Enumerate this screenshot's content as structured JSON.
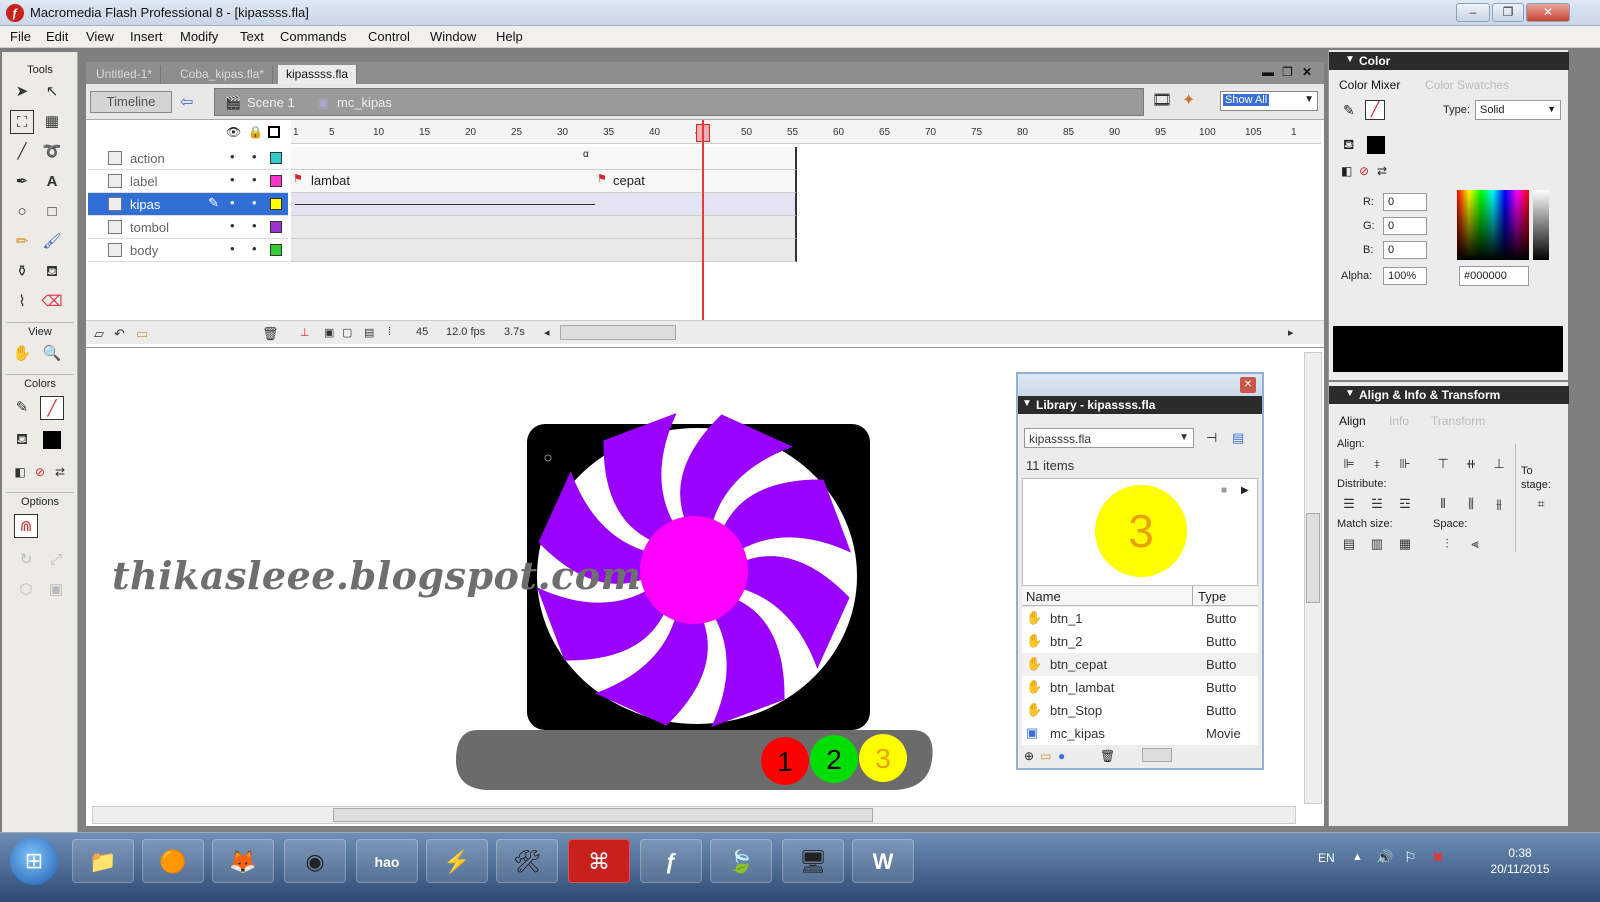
{
  "window": {
    "title": "Macromedia Flash Professional 8 - [kipassss.fla]",
    "app_icon": "flash-logo-icon",
    "controls": [
      "–",
      "❐",
      "✕"
    ]
  },
  "menubar": [
    "File",
    "Edit",
    "View",
    "Insert",
    "Modify",
    "Text",
    "Commands",
    "Control",
    "Window",
    "Help"
  ],
  "tools": {
    "title": "Tools",
    "view_label": "View",
    "colors_label": "Colors",
    "options_label": "Options"
  },
  "document_tabs": [
    {
      "label": "Untitled-1*",
      "active": false
    },
    {
      "label": "Coba_kipas.fla*",
      "active": false
    },
    {
      "label": "kipassss.fla",
      "active": true
    }
  ],
  "edit_bar": {
    "timeline_button": "Timeline",
    "scene": "Scene 1",
    "symbol": "mc_kipas",
    "zoom": "Show All"
  },
  "timeline": {
    "ruler": [
      "1",
      "5",
      "10",
      "15",
      "20",
      "25",
      "30",
      "35",
      "40",
      "45",
      "50",
      "55",
      "60",
      "65",
      "70",
      "75",
      "80",
      "85",
      "90",
      "95",
      "100",
      "105",
      "1"
    ],
    "layers": [
      {
        "name": "action",
        "selected": false,
        "color": "#33cccc",
        "frame_label": ""
      },
      {
        "name": "label",
        "selected": false,
        "color": "#ff33cc",
        "frame_label": ""
      },
      {
        "name": "kipas",
        "selected": true,
        "color": "#ffff00",
        "frame_label": ""
      },
      {
        "name": "tombol",
        "selected": false,
        "color": "#9933cc",
        "frame_label": ""
      },
      {
        "name": "body",
        "selected": false,
        "color": "#33cc33",
        "frame_label": ""
      }
    ],
    "frame_labels": [
      "lambat",
      "cepat"
    ],
    "footer": {
      "current_frame": "45",
      "fps": "12.0 fps",
      "time": "3.7s"
    }
  },
  "stage": {
    "watermark": "thikasleee.blogspot.com",
    "buttons": [
      {
        "label": "1",
        "color": "#ff0000"
      },
      {
        "label": "2",
        "color": "#00dd00"
      },
      {
        "label": "3",
        "color": "#ffff00"
      }
    ],
    "fan_colors": {
      "blade": "#9900ff",
      "hub": "#ff00ff",
      "frame": "#000000",
      "base": "#6b6b6b"
    }
  },
  "library": {
    "title": "Library - kipassss.fla",
    "selector": "kipassss.fla",
    "count": "11 items",
    "preview_label": "3",
    "columns": {
      "name": "Name",
      "type": "Type"
    },
    "items": [
      {
        "name": "btn_1",
        "type": "Butto",
        "icon": "button-symbol-icon"
      },
      {
        "name": "btn_2",
        "type": "Butto",
        "icon": "button-symbol-icon"
      },
      {
        "name": "btn_cepat",
        "type": "Butto",
        "icon": "button-symbol-icon"
      },
      {
        "name": "btn_lambat",
        "type": "Butto",
        "icon": "button-symbol-icon"
      },
      {
        "name": "btn_Stop",
        "type": "Butto",
        "icon": "button-symbol-icon"
      },
      {
        "name": "mc_kipas",
        "type": "Movie",
        "icon": "movieclip-symbol-icon"
      }
    ]
  },
  "color_panel": {
    "title": "Color",
    "tabs": [
      "Color Mixer",
      "Color Swatches"
    ],
    "type_label": "Type:",
    "type_value": "Solid",
    "r_label": "R:",
    "r": "0",
    "g_label": "G:",
    "g": "0",
    "b_label": "B:",
    "b": "0",
    "alpha_label": "Alpha:",
    "alpha": "100%",
    "hex": "#000000"
  },
  "align_panel": {
    "title": "Align & Info & Transform",
    "tabs": [
      "Align",
      "Info",
      "Transform"
    ],
    "align_label": "Align:",
    "distribute_label": "Distribute:",
    "match_size_label": "Match size:",
    "space_label": "Space:",
    "to_stage_label": "To stage:"
  },
  "taskbar": {
    "apps": [
      "explorer-icon",
      "media-icon",
      "firefox-icon",
      "chrome-icon",
      "hao123-icon",
      "pikachu-icon",
      "tools-icon",
      "acrobat-icon",
      "flash-icon",
      "feather-icon",
      "network-icon",
      "word-icon"
    ],
    "lang": "EN",
    "time": "0:38",
    "date": "20/11/2015"
  }
}
